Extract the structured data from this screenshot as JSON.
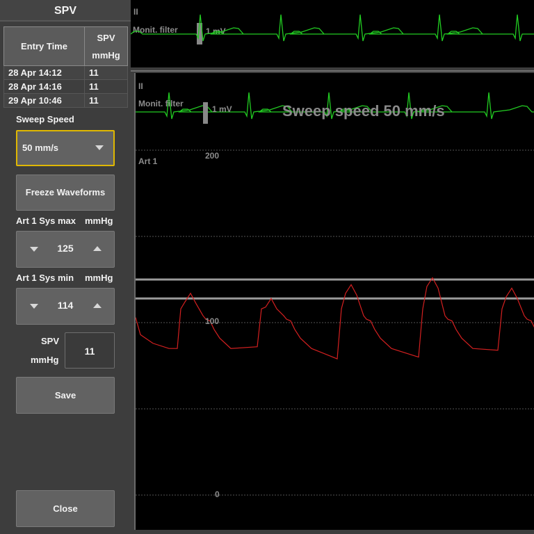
{
  "panel": {
    "title": "SPV",
    "table": {
      "headers": [
        "Entry Time",
        "SPV",
        "mmHg"
      ],
      "rows": [
        {
          "time": "28 Apr 14:12",
          "value": "11"
        },
        {
          "time": "28 Apr 14:16",
          "value": "11"
        },
        {
          "time": "29 Apr 10:46",
          "value": "11"
        }
      ]
    },
    "sweep_speed_label": "Sweep Speed",
    "sweep_speed_value": "50 mm/s",
    "freeze_label": "Freeze Waveforms",
    "sys_max_label": "Art 1 Sys max",
    "sys_max_unit": "mmHg",
    "sys_max_value": "125",
    "sys_min_label": "Art 1 Sys min",
    "sys_min_unit": "mmHg",
    "sys_min_value": "114",
    "spv_label": "SPV",
    "spv_unit": "mmHg",
    "spv_value": "11",
    "save_label": "Save",
    "close_label": "Close",
    "accent_color": "#e0b800"
  },
  "top_ecg": {
    "lead": "II",
    "filter": "Monit. filter",
    "scale": "1 mV",
    "color": "#22cc22"
  },
  "main_ecg": {
    "lead": "II",
    "filter": "Monit. filter",
    "scale": "1 mV",
    "sweep_text": "Sweep speed 50 mm/s",
    "color": "#22cc22"
  },
  "art": {
    "label": "Art 1",
    "ticks": [
      "200",
      "100",
      "0"
    ],
    "gridlines": [
      200,
      150,
      100,
      50,
      0
    ],
    "sys_max": 125,
    "sys_min": 114,
    "color": "#d42020"
  }
}
